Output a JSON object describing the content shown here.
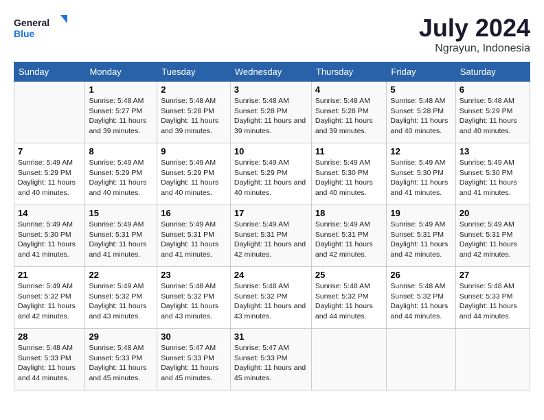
{
  "logo": {
    "line1": "General",
    "line2": "Blue"
  },
  "title": "July 2024",
  "subtitle": "Ngrayun, Indonesia",
  "days_header": [
    "Sunday",
    "Monday",
    "Tuesday",
    "Wednesday",
    "Thursday",
    "Friday",
    "Saturday"
  ],
  "weeks": [
    [
      {
        "day": "",
        "info": ""
      },
      {
        "day": "1",
        "info": "Sunrise: 5:48 AM\nSunset: 5:27 PM\nDaylight: 11 hours and 39 minutes."
      },
      {
        "day": "2",
        "info": "Sunrise: 5:48 AM\nSunset: 5:28 PM\nDaylight: 11 hours and 39 minutes."
      },
      {
        "day": "3",
        "info": "Sunrise: 5:48 AM\nSunset: 5:28 PM\nDaylight: 11 hours and 39 minutes."
      },
      {
        "day": "4",
        "info": "Sunrise: 5:48 AM\nSunset: 5:28 PM\nDaylight: 11 hours and 39 minutes."
      },
      {
        "day": "5",
        "info": "Sunrise: 5:48 AM\nSunset: 5:28 PM\nDaylight: 11 hours and 40 minutes."
      },
      {
        "day": "6",
        "info": "Sunrise: 5:48 AM\nSunset: 5:29 PM\nDaylight: 11 hours and 40 minutes."
      }
    ],
    [
      {
        "day": "7",
        "info": "Sunrise: 5:49 AM\nSunset: 5:29 PM\nDaylight: 11 hours and 40 minutes."
      },
      {
        "day": "8",
        "info": "Sunrise: 5:49 AM\nSunset: 5:29 PM\nDaylight: 11 hours and 40 minutes."
      },
      {
        "day": "9",
        "info": "Sunrise: 5:49 AM\nSunset: 5:29 PM\nDaylight: 11 hours and 40 minutes."
      },
      {
        "day": "10",
        "info": "Sunrise: 5:49 AM\nSunset: 5:29 PM\nDaylight: 11 hours and 40 minutes."
      },
      {
        "day": "11",
        "info": "Sunrise: 5:49 AM\nSunset: 5:30 PM\nDaylight: 11 hours and 40 minutes."
      },
      {
        "day": "12",
        "info": "Sunrise: 5:49 AM\nSunset: 5:30 PM\nDaylight: 11 hours and 41 minutes."
      },
      {
        "day": "13",
        "info": "Sunrise: 5:49 AM\nSunset: 5:30 PM\nDaylight: 11 hours and 41 minutes."
      }
    ],
    [
      {
        "day": "14",
        "info": "Sunrise: 5:49 AM\nSunset: 5:30 PM\nDaylight: 11 hours and 41 minutes."
      },
      {
        "day": "15",
        "info": "Sunrise: 5:49 AM\nSunset: 5:31 PM\nDaylight: 11 hours and 41 minutes."
      },
      {
        "day": "16",
        "info": "Sunrise: 5:49 AM\nSunset: 5:31 PM\nDaylight: 11 hours and 41 minutes."
      },
      {
        "day": "17",
        "info": "Sunrise: 5:49 AM\nSunset: 5:31 PM\nDaylight: 11 hours and 42 minutes."
      },
      {
        "day": "18",
        "info": "Sunrise: 5:49 AM\nSunset: 5:31 PM\nDaylight: 11 hours and 42 minutes."
      },
      {
        "day": "19",
        "info": "Sunrise: 5:49 AM\nSunset: 5:31 PM\nDaylight: 11 hours and 42 minutes."
      },
      {
        "day": "20",
        "info": "Sunrise: 5:49 AM\nSunset: 5:31 PM\nDaylight: 11 hours and 42 minutes."
      }
    ],
    [
      {
        "day": "21",
        "info": "Sunrise: 5:49 AM\nSunset: 5:32 PM\nDaylight: 11 hours and 42 minutes."
      },
      {
        "day": "22",
        "info": "Sunrise: 5:49 AM\nSunset: 5:32 PM\nDaylight: 11 hours and 43 minutes."
      },
      {
        "day": "23",
        "info": "Sunrise: 5:48 AM\nSunset: 5:32 PM\nDaylight: 11 hours and 43 minutes."
      },
      {
        "day": "24",
        "info": "Sunrise: 5:48 AM\nSunset: 5:32 PM\nDaylight: 11 hours and 43 minutes."
      },
      {
        "day": "25",
        "info": "Sunrise: 5:48 AM\nSunset: 5:32 PM\nDaylight: 11 hours and 44 minutes."
      },
      {
        "day": "26",
        "info": "Sunrise: 5:48 AM\nSunset: 5:32 PM\nDaylight: 11 hours and 44 minutes."
      },
      {
        "day": "27",
        "info": "Sunrise: 5:48 AM\nSunset: 5:33 PM\nDaylight: 11 hours and 44 minutes."
      }
    ],
    [
      {
        "day": "28",
        "info": "Sunrise: 5:48 AM\nSunset: 5:33 PM\nDaylight: 11 hours and 44 minutes."
      },
      {
        "day": "29",
        "info": "Sunrise: 5:48 AM\nSunset: 5:33 PM\nDaylight: 11 hours and 45 minutes."
      },
      {
        "day": "30",
        "info": "Sunrise: 5:47 AM\nSunset: 5:33 PM\nDaylight: 11 hours and 45 minutes."
      },
      {
        "day": "31",
        "info": "Sunrise: 5:47 AM\nSunset: 5:33 PM\nDaylight: 11 hours and 45 minutes."
      },
      {
        "day": "",
        "info": ""
      },
      {
        "day": "",
        "info": ""
      },
      {
        "day": "",
        "info": ""
      }
    ]
  ]
}
